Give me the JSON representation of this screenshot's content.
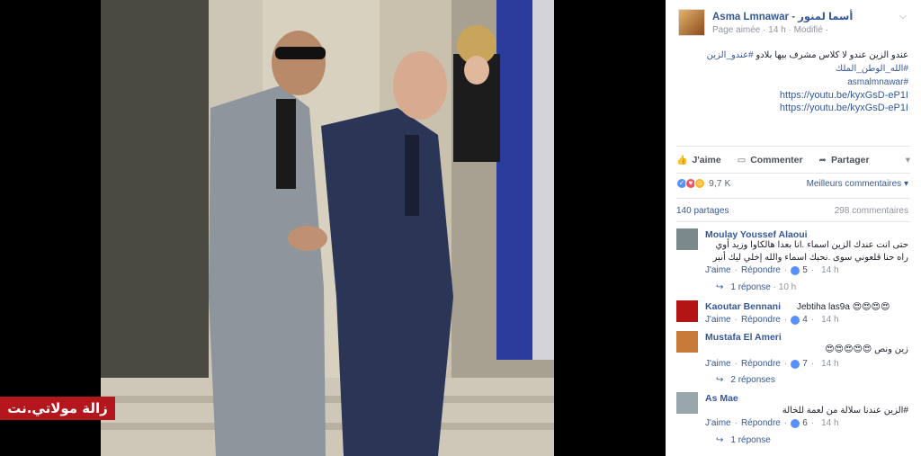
{
  "watermark": "زالة مولاتي.نت",
  "post": {
    "author": "Asma Lmnawar - أسما لمنور",
    "meta": "Page aimée · 14 h · Modifié ·",
    "text_line1": "عندو الزين عندو لا كلاس مشرف بيها بلادو",
    "tag1": "#عندو_الزين",
    "tag2": "#الله_الوطن_الملك",
    "tag3": "#asmalmnawar",
    "link1": "https://youtu.be/kyxGsD-eP1I",
    "link2": "https://youtu.be/kyxGsD-eP1I"
  },
  "actions": {
    "like": "J'aime",
    "comment": "Commenter",
    "share": "Partager"
  },
  "stats": {
    "reactions": "9,7 K",
    "best": "Meilleurs commentaires",
    "shares": "140 partages",
    "comments": "298 commentaires"
  },
  "comments": [
    {
      "name": "Moulay Youssef Alaoui",
      "text": "حتى انت عندك الزين اسماء .انا بعدا هالكاوا وزيد أوي راه حنا قلعوني سوى .نحبك اسماء والله إخلي ليك أنبر",
      "like": "J'aime",
      "reply": "Répondre",
      "likes": "5",
      "time": "14 h",
      "reply_count": "1 réponse",
      "reply_time": "10 h"
    },
    {
      "name": "Kaoutar Bennani",
      "text": "Jebtiha las9a 😍😍😍😍",
      "like": "J'aime",
      "reply": "Répondre",
      "likes": "4",
      "time": "14 h"
    },
    {
      "name": "Mustafa El Ameri",
      "text": "زين ونص 😍😍😍😍😍",
      "like": "J'aime",
      "reply": "Répondre",
      "likes": "7",
      "time": "14 h",
      "reply_count": "2 réponses"
    },
    {
      "name": "As Mae",
      "text": "#الزين عندنا سلالة من لعمة للخالة",
      "like": "J'aime",
      "reply": "Répondre",
      "likes": "6",
      "time": "14 h",
      "reply_count": "1 réponse"
    }
  ]
}
